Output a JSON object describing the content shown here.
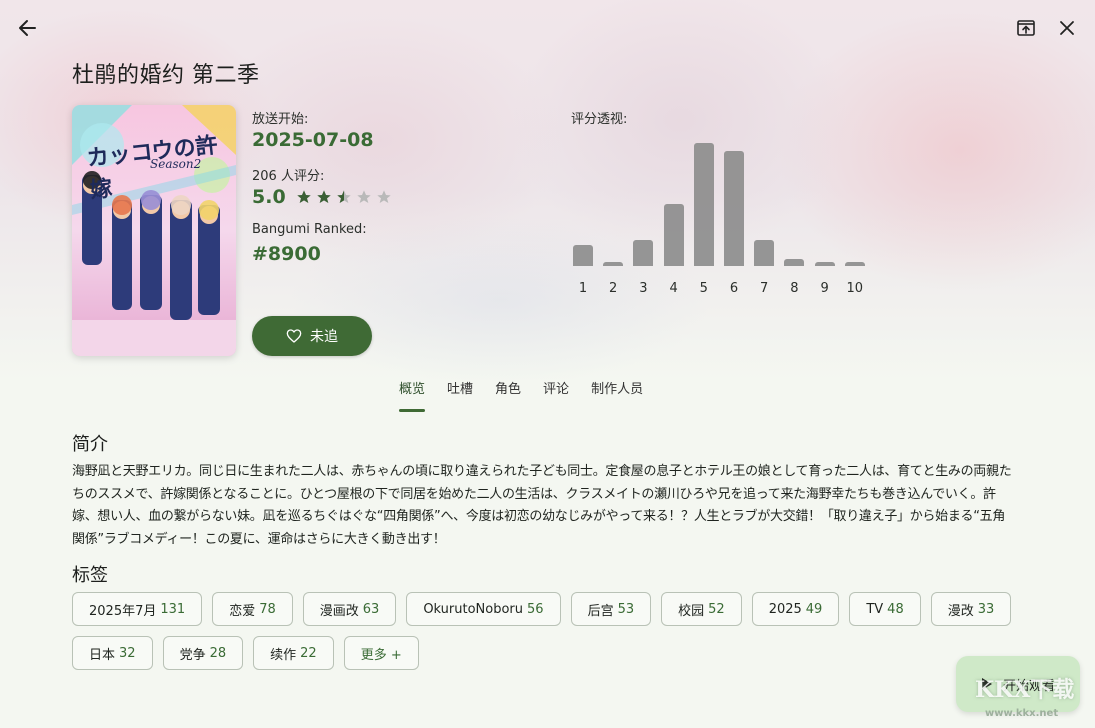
{
  "header": {
    "title": "杜鹃的婚约 第二季",
    "back_icon": "arrow-left-icon",
    "open_external_icon": "open-in-window-icon",
    "close_icon": "close-icon"
  },
  "info": {
    "air_label": "放送开始:",
    "air_date": "2025-07-08",
    "votes_label": "206 人评分:",
    "score": "5.0",
    "rating_stars": 2.5,
    "rank_label": "Bangumi Ranked:",
    "rank": "#8900"
  },
  "poster": {
    "title_text": "カッコウの許嫁",
    "subtitle_text": "Season2"
  },
  "follow_button": {
    "label": "未追",
    "icon": "heart-outline-icon"
  },
  "histogram": {
    "label": "评分透视:",
    "chart_data": {
      "type": "bar",
      "categories": [
        "1",
        "2",
        "3",
        "4",
        "5",
        "6",
        "7",
        "8",
        "9",
        "10"
      ],
      "values": [
        21,
        4,
        26,
        63,
        125,
        117,
        26,
        7,
        4,
        4
      ],
      "ylim": [
        0,
        130
      ]
    }
  },
  "tabs": [
    {
      "label": "概览",
      "active": true
    },
    {
      "label": "吐槽",
      "active": false
    },
    {
      "label": "角色",
      "active": false
    },
    {
      "label": "评论",
      "active": false
    },
    {
      "label": "制作人员",
      "active": false
    }
  ],
  "summary": {
    "title": "简介",
    "text": "海野凪と天野エリカ。同じ日に生まれた二人は、赤ちゃんの頃に取り違えられた子ども同士。定食屋の息子とホテル王の娘として育った二人は、育てと生みの両親たちのススメで、許嫁関係となることに。ひとつ屋根の下で同居を始めた二人の生活は、クラスメイトの瀬川ひろや兄を追って来た海野幸たちも巻き込んでいく。許嫁、想い人、血の繋がらない妹。凪を巡るちぐはぐな“四角関係”へ、今度は初恋の幼なじみがやって来る！？人生とラブが大交錯！「取り違え子」から始まる“五角関係”ラブコメディー！この夏に、運命はさらに大きく動き出す！"
  },
  "tags_section": {
    "title": "标签",
    "tags": [
      {
        "name": "2025年7月",
        "count": "131"
      },
      {
        "name": "恋爱",
        "count": "78"
      },
      {
        "name": "漫画改",
        "count": "63"
      },
      {
        "name": "OkurutoNoboru",
        "count": "56"
      },
      {
        "name": "后宫",
        "count": "53"
      },
      {
        "name": "校园",
        "count": "52"
      },
      {
        "name": "2025",
        "count": "49"
      },
      {
        "name": "TV",
        "count": "48"
      },
      {
        "name": "漫改",
        "count": "33"
      },
      {
        "name": "日本",
        "count": "32"
      },
      {
        "name": "党争",
        "count": "28"
      },
      {
        "name": "续作",
        "count": "22"
      }
    ],
    "more_label": "更多 +"
  },
  "play_button": {
    "label": "开始观看",
    "icon": "play-icon"
  },
  "watermark": {
    "text": "KKX下载",
    "url": "www.kkx.net"
  },
  "colors": {
    "accent": "#3f6a35",
    "score": "#3a6b35",
    "bar": "#8d8d8d",
    "play_bg": "#cfe9c8"
  }
}
